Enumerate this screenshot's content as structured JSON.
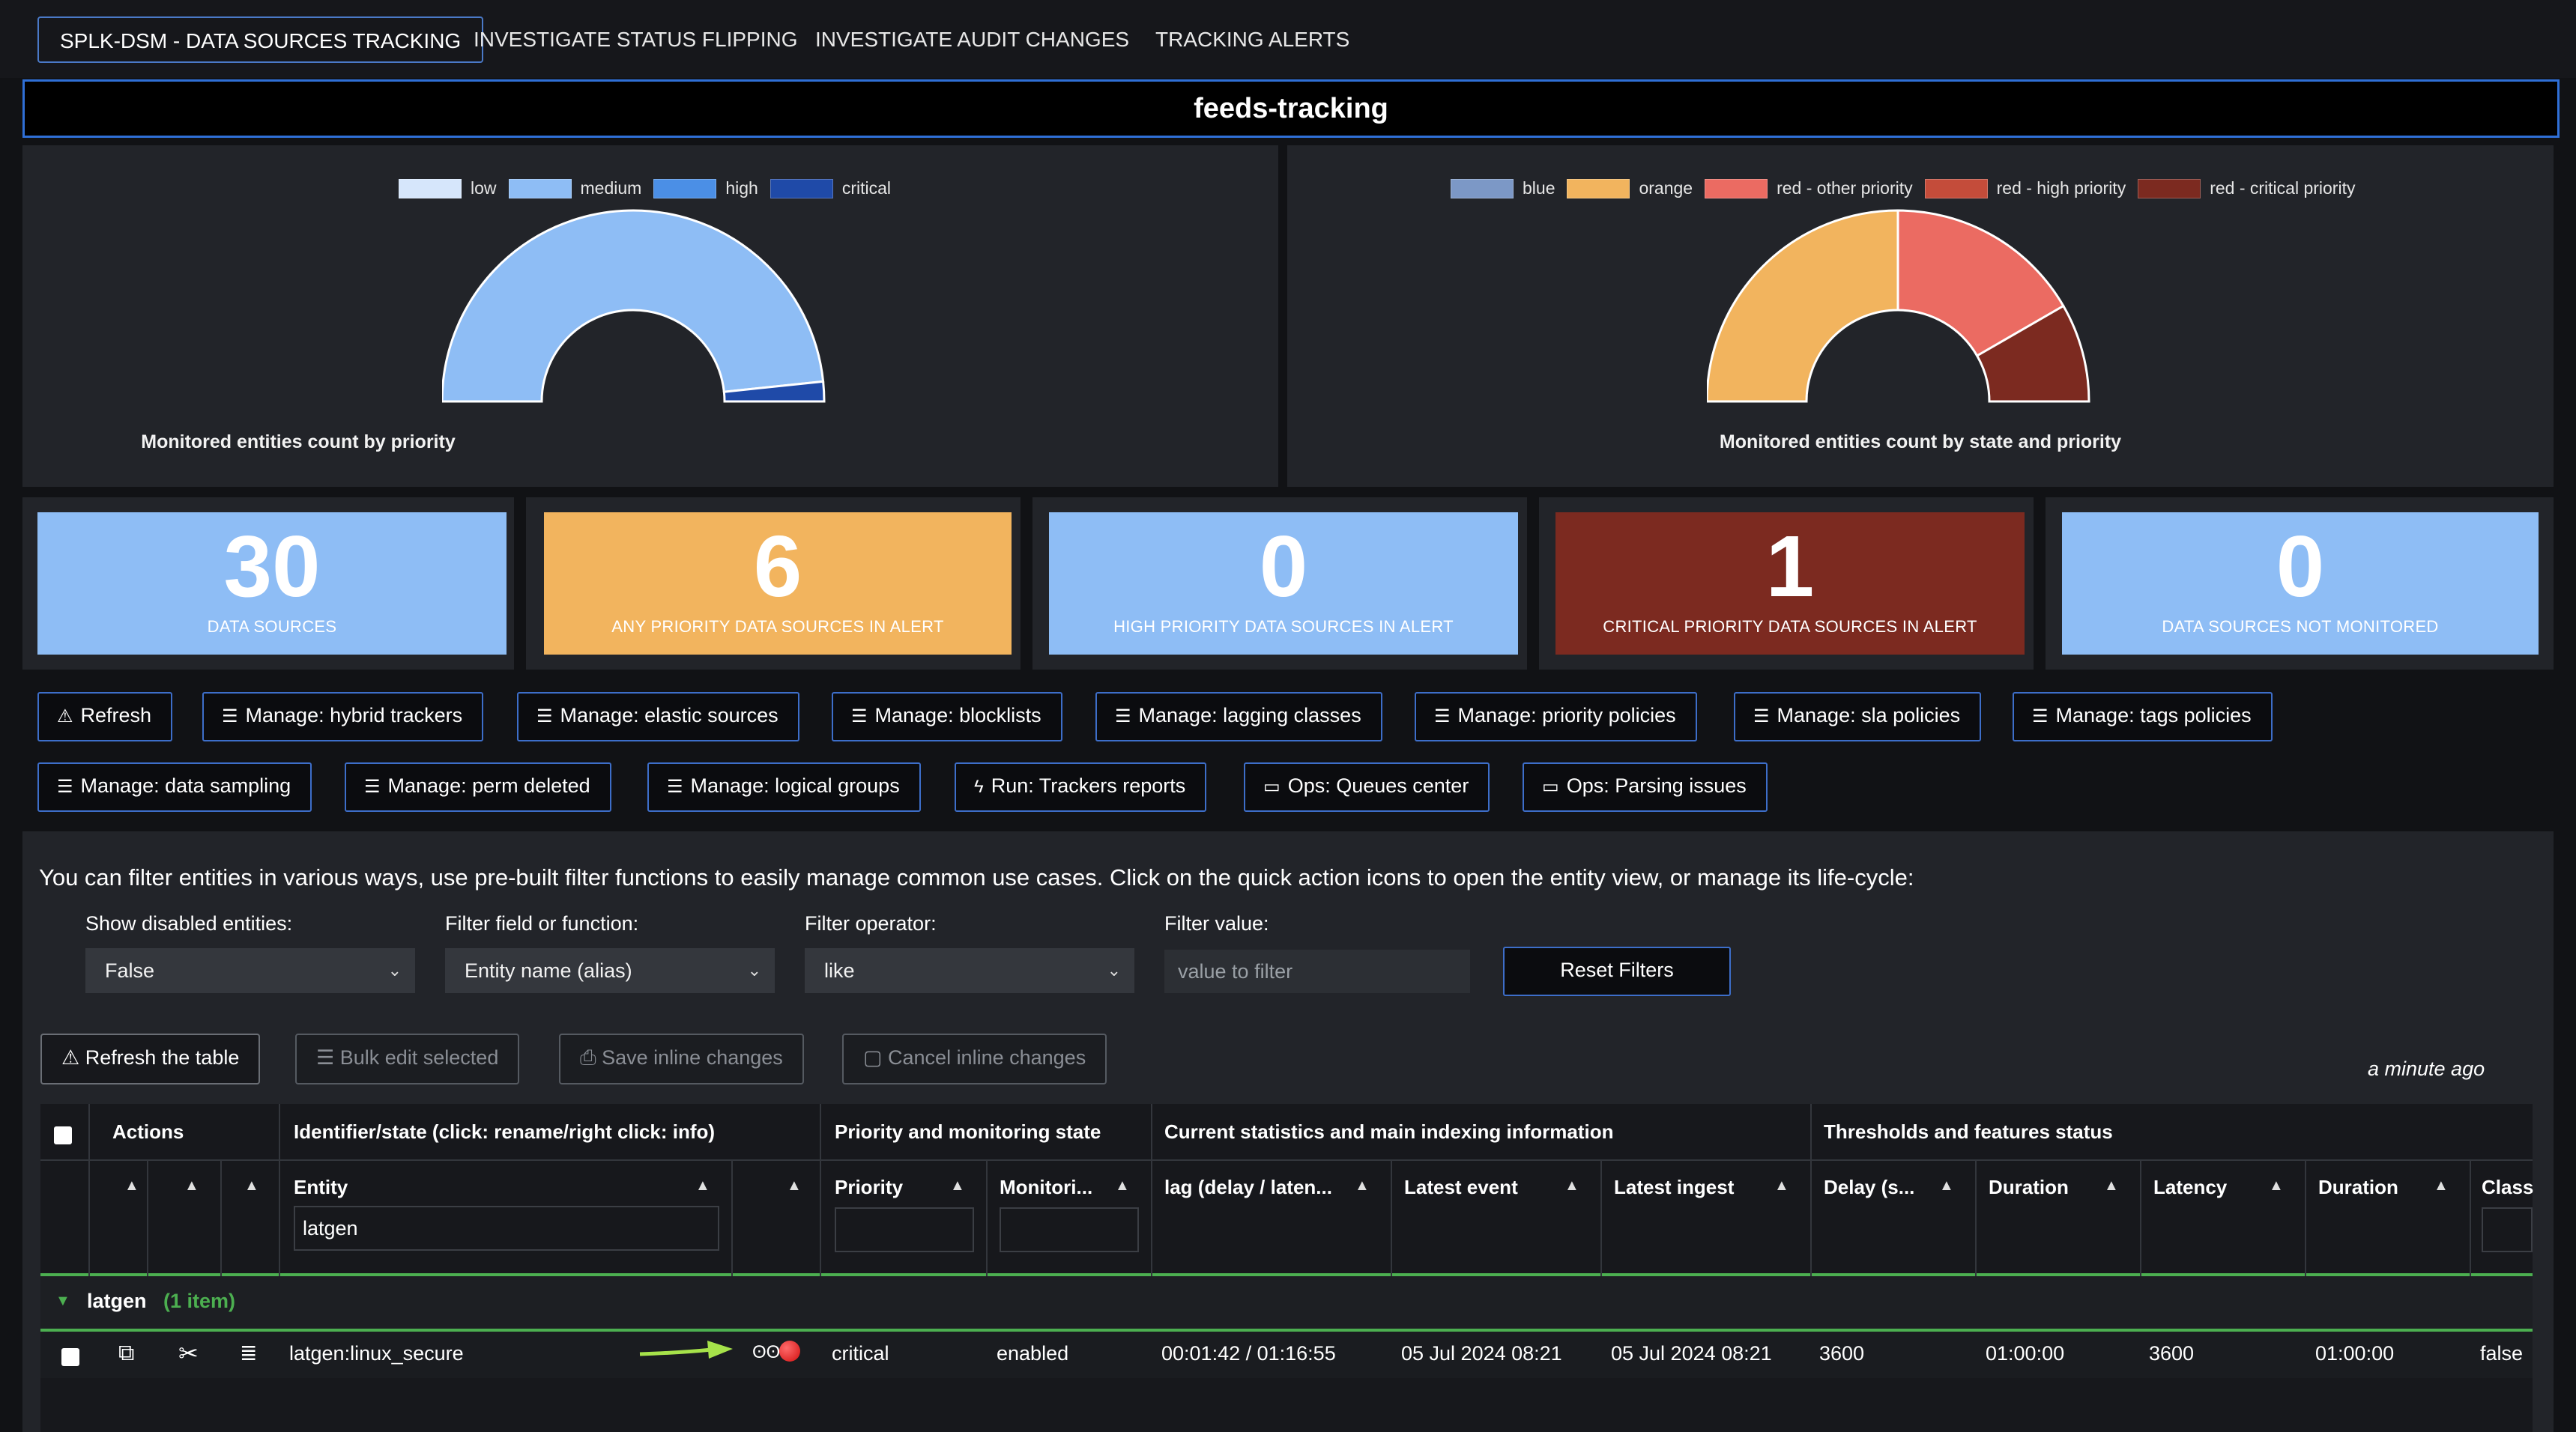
{
  "tabs": [
    {
      "label": "SPLK-DSM - DATA SOURCES TRACKING",
      "active": true
    },
    {
      "label": "INVESTIGATE STATUS FLIPPING",
      "active": false
    },
    {
      "label": "INVESTIGATE AUDIT CHANGES",
      "active": false
    },
    {
      "label": "TRACKING ALERTS",
      "active": false
    }
  ],
  "dashboard_title": "feeds-tracking",
  "chart_data": [
    {
      "type": "pie",
      "variant": "semi-donut",
      "title": "Monitored entities count by priority",
      "legend": [
        "low",
        "medium",
        "high",
        "critical"
      ],
      "colors": [
        "#d6e6fb",
        "#8ebdf5",
        "#4b8fe6",
        "#1f4aa8"
      ],
      "values": [
        0,
        29,
        0,
        1
      ]
    },
    {
      "type": "pie",
      "variant": "semi-donut",
      "title": "Monitored entities count by state and priority",
      "legend": [
        "blue",
        "orange",
        "red - other priority",
        "red - high priority",
        "red - critical priority"
      ],
      "colors": [
        "#7c98c6",
        "#f2b45e",
        "#eb6b62",
        "#c44c3a",
        "#7c2a20"
      ],
      "values": [
        0,
        3,
        2,
        0,
        1
      ]
    }
  ],
  "kpis": [
    {
      "value": "30",
      "label": "DATA SOURCES",
      "color": "#8ebdf5"
    },
    {
      "value": "6",
      "label": "ANY PRIORITY DATA SOURCES IN ALERT",
      "color": "#f2b45e"
    },
    {
      "value": "0",
      "label": "HIGH PRIORITY DATA SOURCES IN ALERT",
      "color": "#8ebdf5"
    },
    {
      "value": "1",
      "label": "CRITICAL PRIORITY DATA SOURCES IN ALERT",
      "color": "#7c2a20"
    },
    {
      "value": "0",
      "label": "DATA SOURCES NOT MONITORED",
      "color": "#8ebdf5"
    }
  ],
  "actions_row1": [
    {
      "label": "Refresh",
      "icon": "alert-triangle-icon"
    },
    {
      "label": "Manage: hybrid trackers",
      "icon": "sliders-icon"
    },
    {
      "label": "Manage: elastic sources",
      "icon": "sliders-icon"
    },
    {
      "label": "Manage: blocklists",
      "icon": "sliders-icon"
    },
    {
      "label": "Manage: lagging classes",
      "icon": "sliders-icon"
    },
    {
      "label": "Manage: priority policies",
      "icon": "sliders-icon"
    },
    {
      "label": "Manage: sla policies",
      "icon": "sliders-icon"
    },
    {
      "label": "Manage: tags policies",
      "icon": "sliders-icon"
    }
  ],
  "actions_row2": [
    {
      "label": "Manage: data sampling",
      "icon": "sliders-icon"
    },
    {
      "label": "Manage: perm deleted",
      "icon": "sliders-icon"
    },
    {
      "label": "Manage: logical groups",
      "icon": "sliders-icon"
    },
    {
      "label": "Run: Trackers reports",
      "icon": "bolt-icon"
    },
    {
      "label": "Ops: Queues center",
      "icon": "monitor-icon"
    },
    {
      "label": "Ops: Parsing issues",
      "icon": "monitor-icon"
    }
  ],
  "filters": {
    "intro": "You can filter entities in various ways, use pre-built filter functions to easily manage common use cases. Click on the quick action icons to open the entity view, or manage its life-cycle:",
    "show_disabled_label": "Show disabled entities:",
    "show_disabled_value": "False",
    "field_label": "Filter field or function:",
    "field_value": "Entity name (alias)",
    "operator_label": "Filter operator:",
    "operator_value": "like",
    "value_label": "Filter value:",
    "value_placeholder": "value to filter",
    "reset_label": "Reset Filters"
  },
  "table_toolbar": {
    "refresh": "Refresh the table",
    "bulk": "Bulk edit selected",
    "save": "Save inline changes",
    "cancel": "Cancel inline changes",
    "updated": "a minute ago"
  },
  "table": {
    "groups": [
      "Actions",
      "Identifier/state (click: rename/right click: info)",
      "Priority and monitoring state",
      "Current statistics and main indexing information",
      "Thresholds and features status"
    ],
    "columns": [
      "Entity",
      "Priority",
      "Monitori...",
      "lag (delay / laten...",
      "Latest event",
      "Latest ingest",
      "Delay (s...",
      "Duration",
      "Latency",
      "Duration",
      "Class"
    ],
    "entity_filter": "latgen",
    "group_row": {
      "name": "latgen",
      "count": "(1 item)"
    },
    "rows": [
      {
        "entity": "latgen:linux_secure",
        "priority": "critical",
        "monitoring": "enabled",
        "lag": "00:01:42 / 01:16:55",
        "latest_event": "05 Jul 2024 08:21",
        "latest_ingest": "05 Jul 2024 08:21",
        "delay": "3600",
        "duration1": "01:00:00",
        "latency": "3600",
        "duration2": "01:00:00",
        "class": "false"
      }
    ]
  }
}
